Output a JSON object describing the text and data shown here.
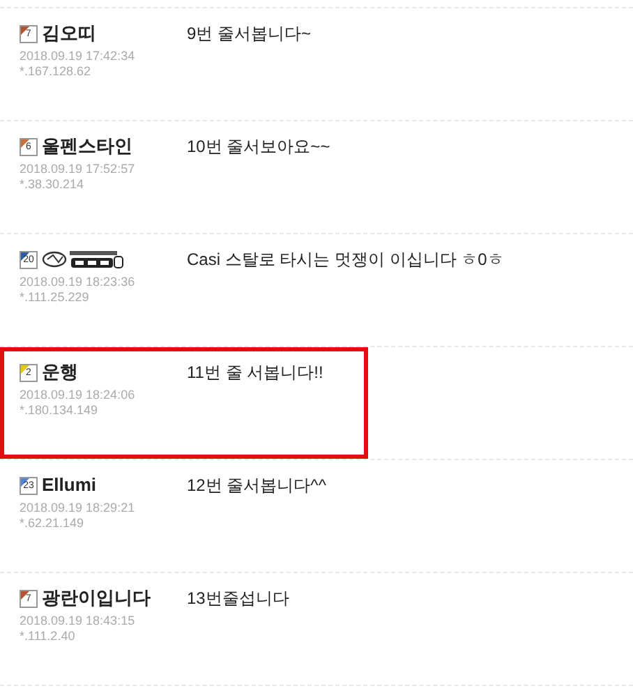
{
  "comments": [
    {
      "level": "7",
      "color": "#b5532f",
      "kind": "text",
      "name": "김오띠",
      "date": "2018.09.19 17:42:34",
      "ip": "*.167.128.62",
      "message": "9번 줄서봅니다~",
      "highlighted": false
    },
    {
      "level": "6",
      "color": "#c8703a",
      "kind": "text",
      "name": "울펜스타인",
      "date": "2018.09.19 17:52:57",
      "ip": "*.38.30.214",
      "message": "10번 줄서보아요~~",
      "highlighted": false
    },
    {
      "level": "20",
      "color": "#2a5ca8",
      "kind": "image",
      "date": "2018.09.19 18:23:36",
      "ip": "*.111.25.229",
      "message": "Casi 스탈로 타시는 멋쟁이 이십니다 ㅎ0ㅎ",
      "highlighted": false
    },
    {
      "level": "2",
      "color": "#e8c51c",
      "kind": "text",
      "name": "운행",
      "date": "2018.09.19 18:24:06",
      "ip": "*.180.134.149",
      "message": "11번 줄 서봅니다!!",
      "highlighted": true
    },
    {
      "level": "23",
      "color": "#4f86d8",
      "kind": "text",
      "name": "Ellumi",
      "date": "2018.09.19 18:29:21",
      "ip": "*.62.21.149",
      "message": "12번 줄서봅니다^^",
      "highlighted": false
    },
    {
      "level": "7",
      "color": "#b5532f",
      "kind": "text",
      "name": "광란이입니다",
      "date": "2018.09.19 18:43:15",
      "ip": "*.111.2.40",
      "message": "13번줄섭니다",
      "highlighted": false
    }
  ]
}
